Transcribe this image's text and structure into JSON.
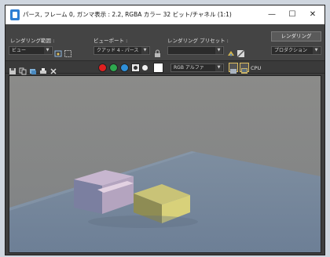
{
  "window": {
    "title": "パース, フレーム 0, ガンマ表示 : 2.2, RGBA カラー 32 ビット/チャネル (1:1)",
    "controls": [
      "—",
      "☐",
      "✕"
    ]
  },
  "topbar": {
    "render_area_label": "レンダリング範囲 :",
    "render_area_value": "ビュー",
    "viewport_label": "ビューポート :",
    "viewport_value": "クアッド 4 - パース",
    "preset_label": "レンダリング プリセット :",
    "preset_value": "",
    "render_button": "レンダリング",
    "production_value": "プロダクション"
  },
  "toolbar": {
    "channel_value": "RGB アルファ",
    "cpu_label": "CPU",
    "channel_colors": {
      "red": "#e02020",
      "green": "#2fa84f",
      "blue": "#2f8fd8"
    }
  }
}
